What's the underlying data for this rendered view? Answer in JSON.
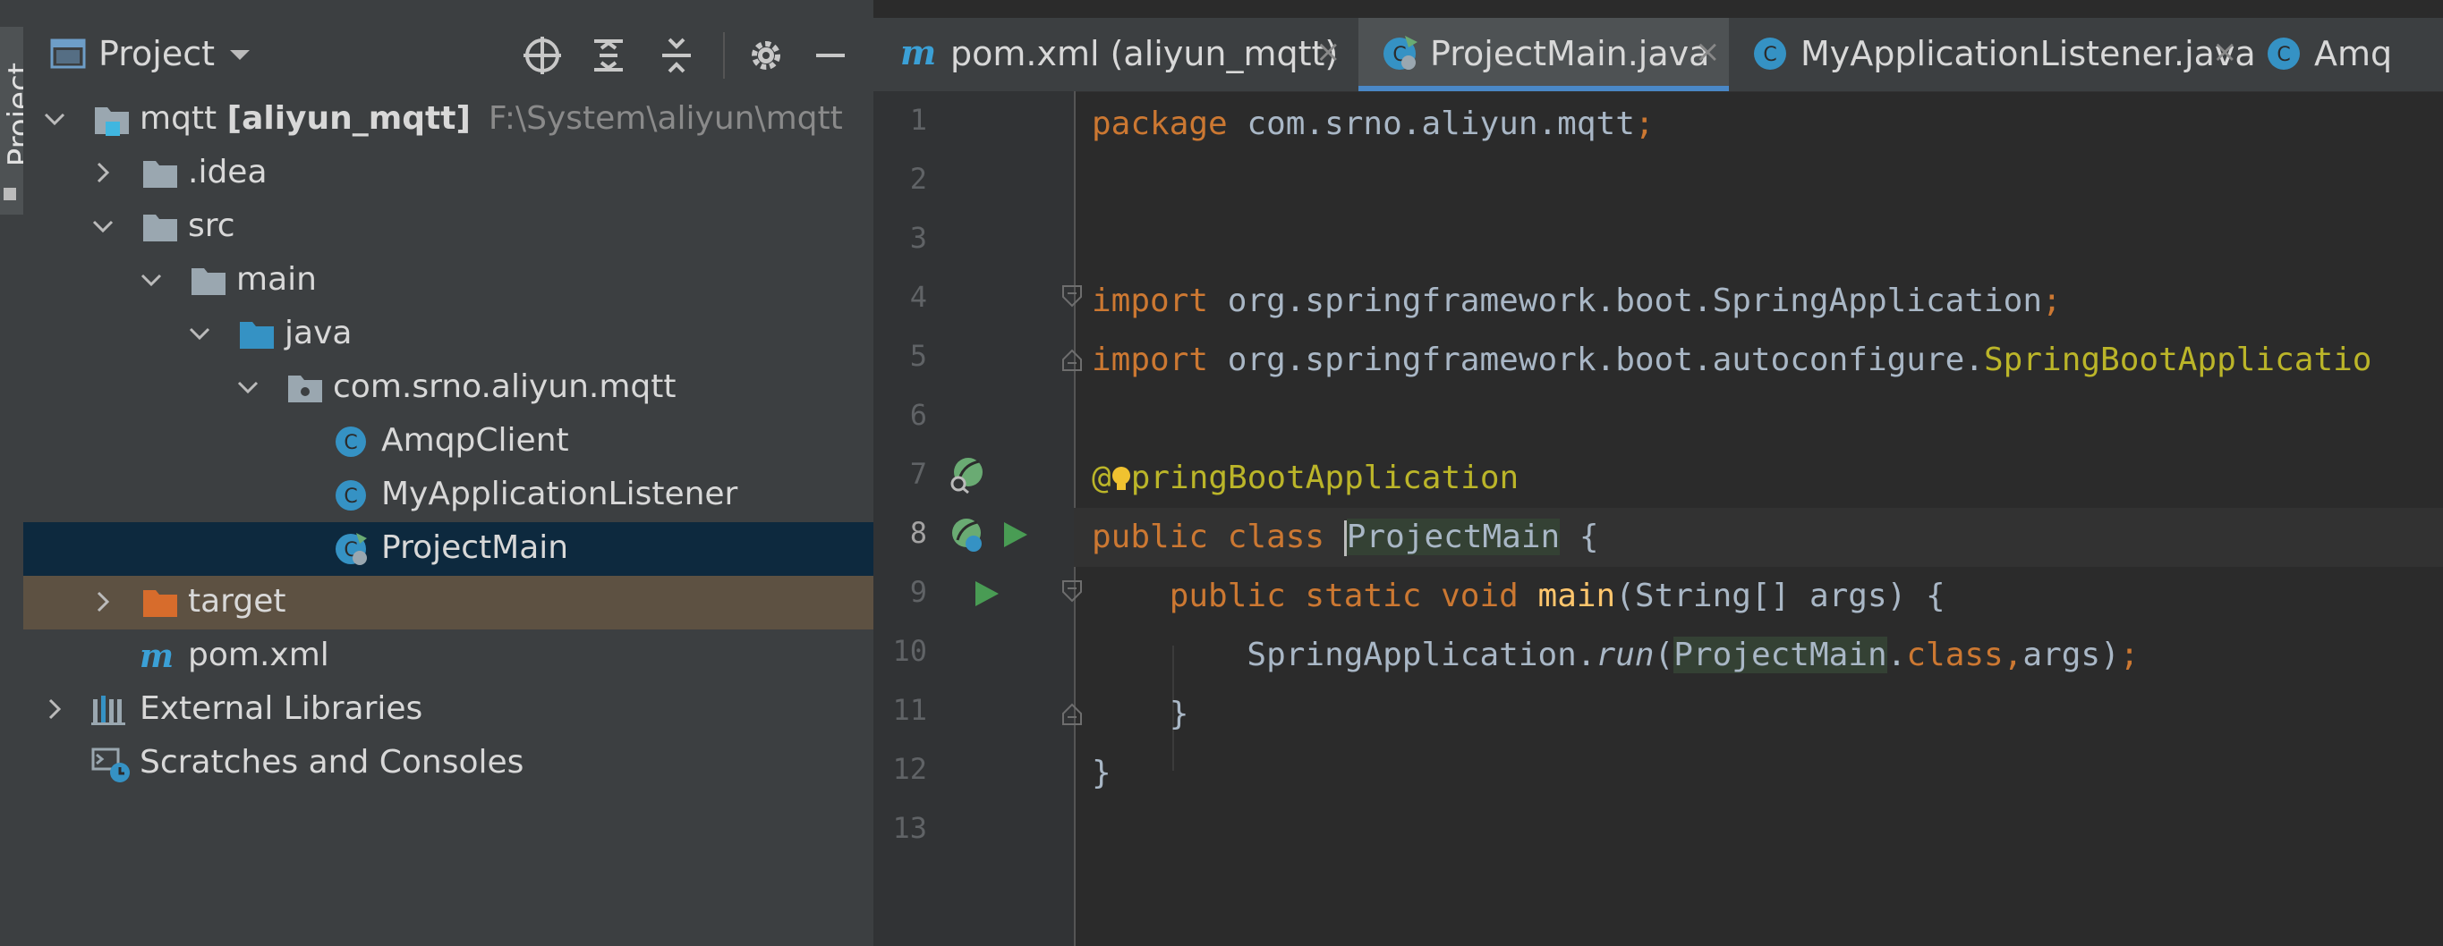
{
  "project_panel": {
    "title": "Project",
    "header_icons": [
      "locate-icon",
      "expand-all-icon",
      "collapse-all-icon",
      "gear-icon",
      "minimize-icon"
    ],
    "tree": [
      {
        "name": "mqtt",
        "bold_suffix": "[aliyun_mqtt]",
        "path": "F:\\System\\aliyun\\mqtt",
        "type": "module"
      },
      {
        "name": ".idea",
        "type": "folder"
      },
      {
        "name": "src",
        "type": "folder"
      },
      {
        "name": "main",
        "type": "folder"
      },
      {
        "name": "java",
        "type": "source-folder"
      },
      {
        "name": "com.srno.aliyun.mqtt",
        "type": "package"
      },
      {
        "name": "AmqpClient",
        "type": "class"
      },
      {
        "name": "MyApplicationListener",
        "type": "class"
      },
      {
        "name": "ProjectMain",
        "type": "spring-class"
      },
      {
        "name": "target",
        "type": "excluded-folder"
      },
      {
        "name": "pom.xml",
        "type": "maven"
      },
      {
        "name": "External Libraries",
        "type": "libraries"
      },
      {
        "name": "Scratches and Consoles",
        "type": "scratches"
      }
    ]
  },
  "side_strip": {
    "label": "Project"
  },
  "tabs": [
    {
      "label": "pom.xml (aliyun_mqtt)",
      "icon": "maven-icon",
      "close": "×"
    },
    {
      "label": "ProjectMain.java",
      "icon": "spring-class-icon",
      "close": "×",
      "active": true
    },
    {
      "label": "MyApplicationListener.java",
      "icon": "class-icon",
      "close": "×"
    },
    {
      "label": "Amq",
      "icon": "class-icon"
    }
  ],
  "editor": {
    "line_numbers": [
      "1",
      "2",
      "3",
      "4",
      "5",
      "6",
      "7",
      "8",
      "9",
      "10",
      "11",
      "12",
      "13"
    ],
    "current_line": "8",
    "code": {
      "l1_kw": "package",
      "l1_rest": " com.srno.aliyun.mqtt",
      "l1_semi": ";",
      "l4_kw": "import",
      "l4_rest": " org.springframework.boot.SpringApplication",
      "l4_semi": ";",
      "l5_kw": "import",
      "l5_rest": " org.springframework.boot.autoconfigure.",
      "l5_ann": "SpringBootApplicatio",
      "l7_at": "@",
      "l7_ann": "pringBootApplication",
      "l8_kw": "public class ",
      "l8_name": "ProjectMain",
      "l8_rest": " {",
      "l9_indent": "    ",
      "l9_kw": "public static void ",
      "l9_fn": "main",
      "l9_rest": "(String[] args) {",
      "l10_indent": "        ",
      "l10_a": "SpringApplication.",
      "l10_run": "run",
      "l10_b": "(",
      "l10_hl": "ProjectMain",
      "l10_c": ".",
      "l10_kw": "class,",
      "l10_d": "args)",
      "l10_semi": ";",
      "l11": "    }",
      "l12": "}"
    }
  }
}
